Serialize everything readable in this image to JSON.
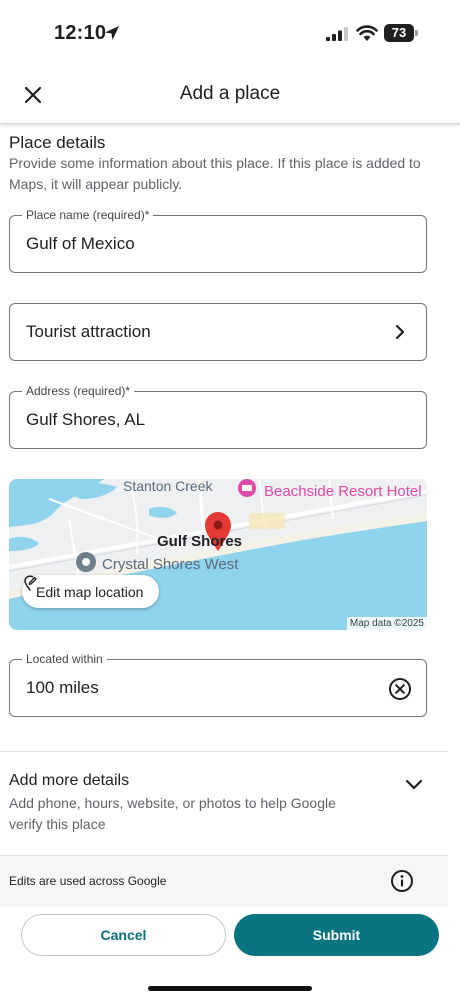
{
  "status_bar": {
    "time": "12:10",
    "battery": "73"
  },
  "header": {
    "title": "Add a place"
  },
  "place_details": {
    "title": "Place details",
    "description": "Provide some information about this place. If this place is added to Maps, it will appear publicly."
  },
  "fields": {
    "place_name": {
      "label": "Place name (required)*",
      "value": "Gulf of Mexico"
    },
    "category": {
      "value": "Tourist attraction"
    },
    "address": {
      "label": "Address (required)*",
      "value": "Gulf Shores, AL"
    },
    "located_within": {
      "label": "Located within",
      "value": "100 miles"
    }
  },
  "map": {
    "labels": {
      "stanton_creek": "Stanton Creek",
      "hotel": "Beachside Resort Hotel",
      "city": "Gulf Shores",
      "crystal_shores": "Crystal Shores West"
    },
    "edit_label": "Edit map location",
    "credit": "Map data ©2025",
    "colors": {
      "water": "#8fd3ec",
      "pin": "#e53935",
      "hotel": "#e04ba8"
    }
  },
  "more_details": {
    "title": "Add more details",
    "description": "Add phone, hours, website, or photos to help Google verify this place"
  },
  "footer": {
    "note": "Edits are used across Google"
  },
  "actions": {
    "cancel": "Cancel",
    "submit": "Submit"
  },
  "colors": {
    "accent": "#0b7481"
  }
}
